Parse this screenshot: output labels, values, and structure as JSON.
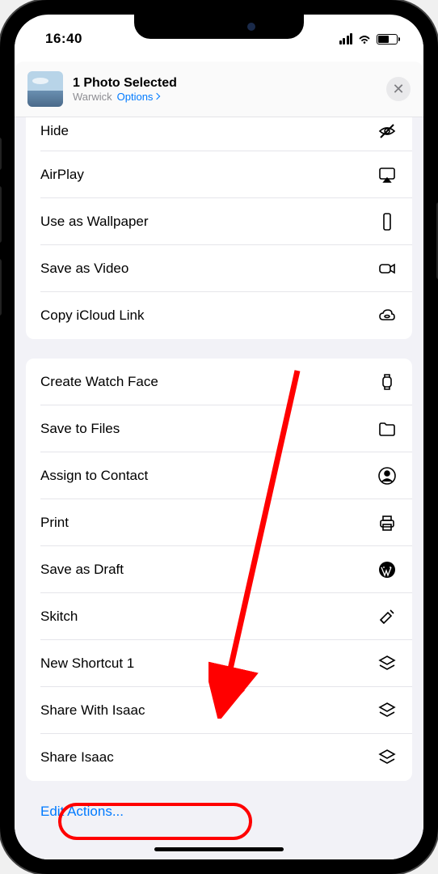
{
  "status": {
    "time": "16:40"
  },
  "header": {
    "title": "1 Photo Selected",
    "location": "Warwick",
    "options_label": "Options"
  },
  "group1": [
    {
      "label": "Hide",
      "icon": "eye-slash"
    },
    {
      "label": "AirPlay",
      "icon": "airplay"
    },
    {
      "label": "Use as Wallpaper",
      "icon": "phone"
    },
    {
      "label": "Save as Video",
      "icon": "video"
    },
    {
      "label": "Copy iCloud Link",
      "icon": "cloud-link"
    }
  ],
  "group2": [
    {
      "label": "Create Watch Face",
      "icon": "watch"
    },
    {
      "label": "Save to Files",
      "icon": "folder"
    },
    {
      "label": "Assign to Contact",
      "icon": "person-circle"
    },
    {
      "label": "Print",
      "icon": "printer"
    },
    {
      "label": "Save as Draft",
      "icon": "wordpress"
    },
    {
      "label": "Skitch",
      "icon": "skitch"
    },
    {
      "label": "New Shortcut 1",
      "icon": "layers"
    },
    {
      "label": "Share With Isaac",
      "icon": "layers"
    },
    {
      "label": "Share Isaac",
      "icon": "layers"
    }
  ],
  "edit": {
    "label": "Edit Actions..."
  }
}
